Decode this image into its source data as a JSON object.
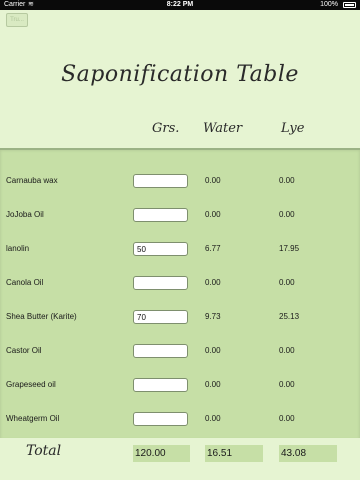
{
  "status_bar": {
    "carrier": "Carrier",
    "time": "8:22 PM",
    "battery": "100%",
    "wifi_icon": "wifi-icon",
    "battery_icon": "battery-icon"
  },
  "toolbar": {
    "back_label": "Tru..."
  },
  "title": "Saponification Table",
  "columns": {
    "grs": "Grs.",
    "water": "Water",
    "lye": "Lye"
  },
  "rows": [
    {
      "name": "Carnauba wax",
      "grs": "",
      "water": "0.00",
      "lye": "0.00"
    },
    {
      "name": "JoJoba Oil",
      "grs": "",
      "water": "0.00",
      "lye": "0.00"
    },
    {
      "name": "lanolin",
      "grs": "50",
      "water": "6.77",
      "lye": "17.95"
    },
    {
      "name": "Canola Oil",
      "grs": "",
      "water": "0.00",
      "lye": "0.00"
    },
    {
      "name": "Shea Butter (Karite)",
      "grs": "70",
      "water": "9.73",
      "lye": "25.13"
    },
    {
      "name": "Castor Oil",
      "grs": "",
      "water": "0.00",
      "lye": "0.00"
    },
    {
      "name": "Grapeseed oil",
      "grs": "",
      "water": "0.00",
      "lye": "0.00"
    },
    {
      "name": "Wheatgerm Oil",
      "grs": "",
      "water": "0.00",
      "lye": "0.00"
    }
  ],
  "total": {
    "label": "Total",
    "grs": "120.00",
    "water": "16.51",
    "lye": "43.08"
  },
  "colors": {
    "background": "#e6f4d2",
    "panel": "#c6dfa6",
    "status_bar": "#0a0a0a"
  }
}
